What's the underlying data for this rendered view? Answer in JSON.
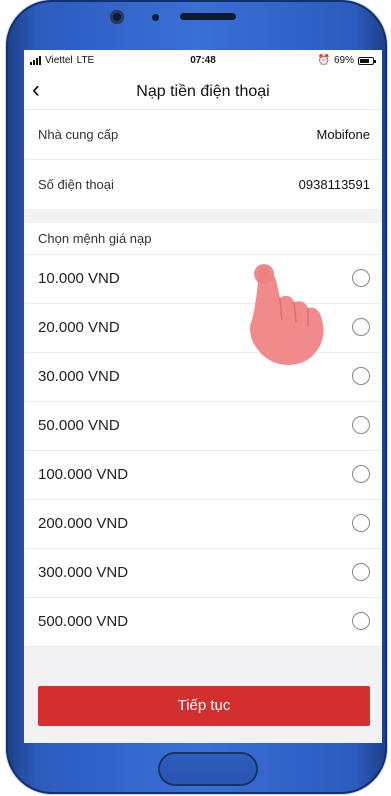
{
  "status_bar": {
    "carrier": "Viettel",
    "network": "LTE",
    "time": "07:48",
    "battery": "69%"
  },
  "nav": {
    "back_icon": "chevron-left-icon",
    "title": "Nạp tiền điện thoại"
  },
  "info": [
    {
      "label": "Nhà cung cấp",
      "value": "Mobifone"
    },
    {
      "label": "Số điện thoại",
      "value": "0938113591"
    }
  ],
  "denominations": {
    "heading": "Chọn mệnh giá nạp",
    "options": [
      {
        "label": "10.000 VND"
      },
      {
        "label": "20.000 VND"
      },
      {
        "label": "30.000 VND"
      },
      {
        "label": "50.000 VND"
      },
      {
        "label": "100.000 VND"
      },
      {
        "label": "200.000 VND"
      },
      {
        "label": "300.000 VND"
      },
      {
        "label": "500.000 VND"
      }
    ]
  },
  "continue_button": {
    "label": "Tiếp tục"
  },
  "colors": {
    "primary_button": "#d32f2f",
    "phone_frame": "#2c5bbd",
    "pointer_hand": "#f08080"
  }
}
